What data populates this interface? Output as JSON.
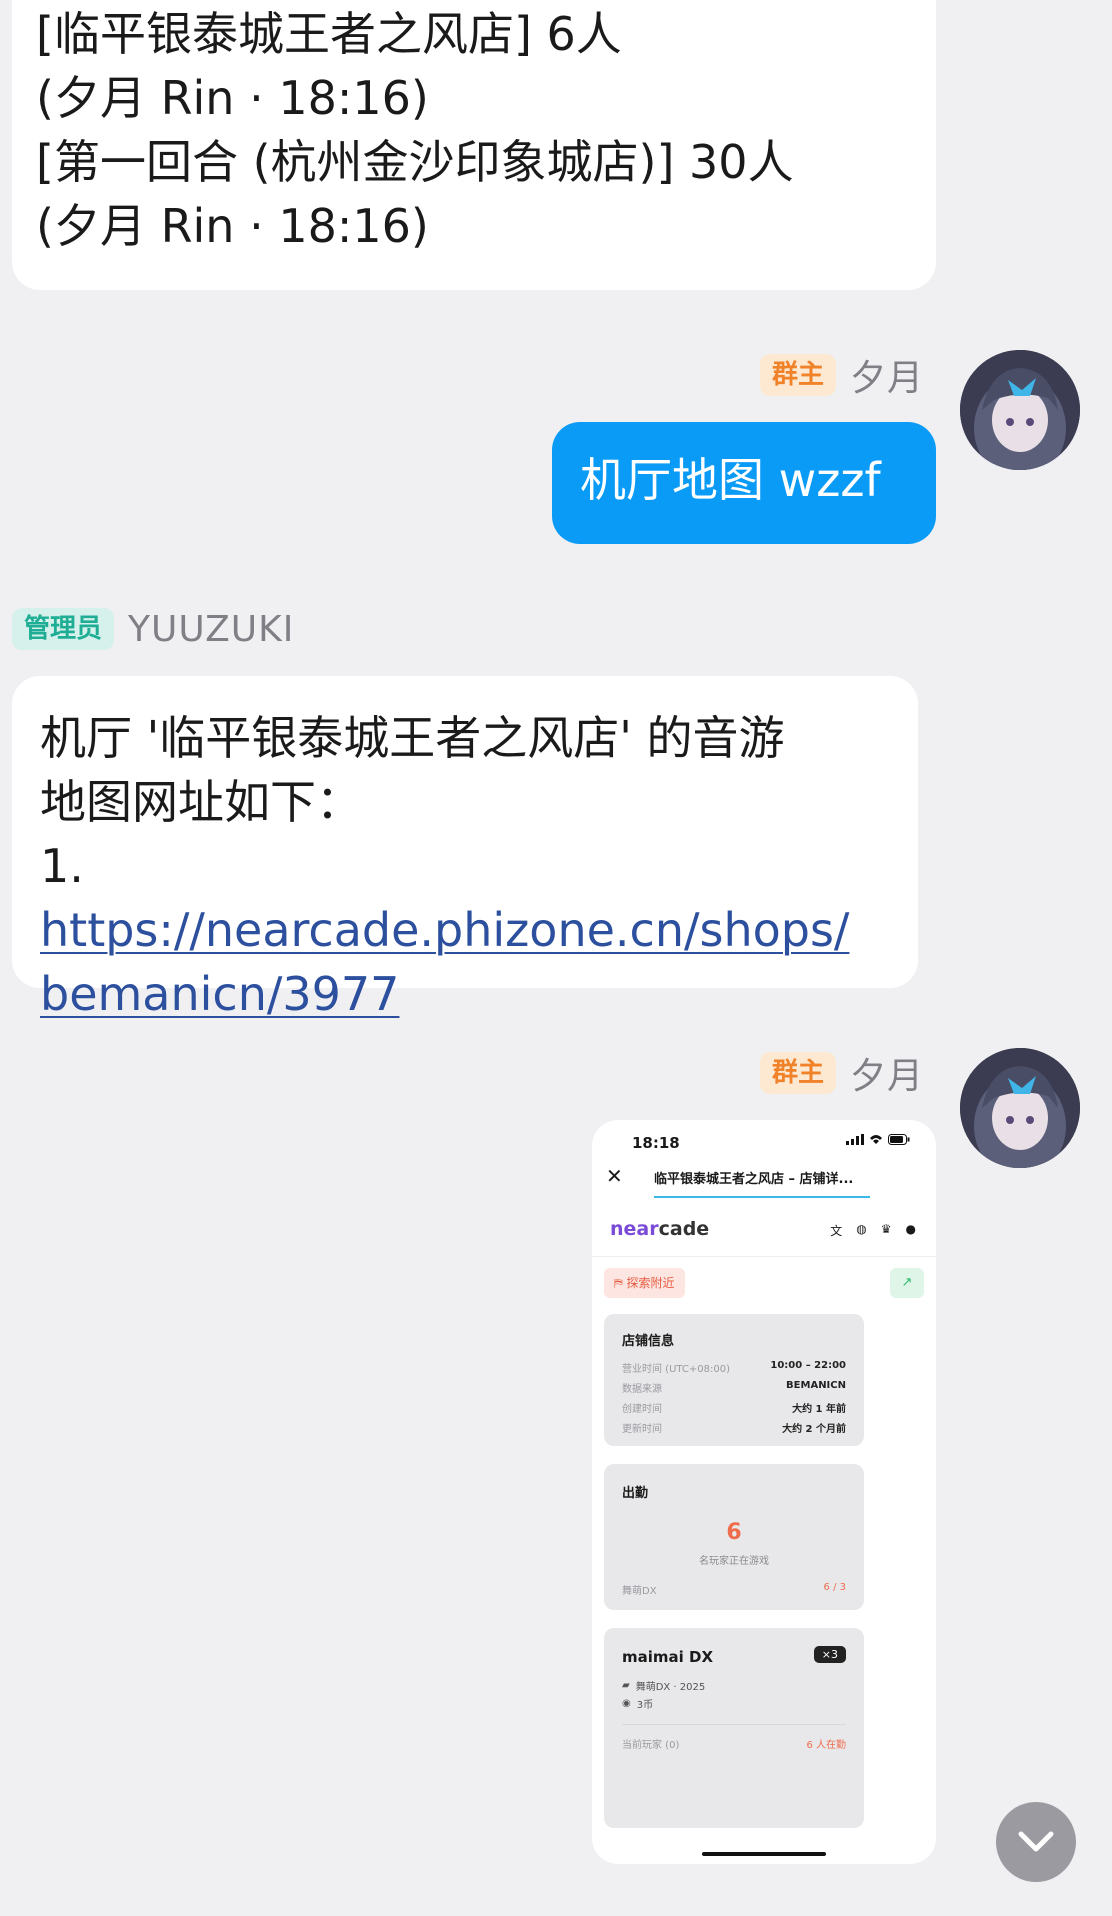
{
  "messages": {
    "m1": {
      "lines": [
        "[临平银泰城王者之风店] 6人",
        "(夕月 Rin · 18:16)",
        "[第一回合 (杭州金沙印象城店)] 30人",
        "(夕月 Rin · 18:16)"
      ]
    },
    "m2": {
      "badge": "群主",
      "sender": "夕月",
      "text": "机厅地图 wzzf"
    },
    "m3": {
      "badge": "管理员",
      "sender": "YUUZUKI",
      "line1": "机厅 '临平银泰城王者之风店' 的音游",
      "line2": "地图网址如下：",
      "list_prefix": "1. ",
      "link_part1": "https://nearcade.phizone.cn/shops/",
      "link_part2": "bemanicn/3977"
    },
    "m4": {
      "badge": "群主",
      "sender": "夕月"
    }
  },
  "screenshot": {
    "time": "18:18",
    "nav_title": "临平银泰城王者之风店 – 店铺详...",
    "logo_a": "near",
    "logo_b": "cade",
    "explore_label": "探索附近",
    "info_card": {
      "title": "店铺信息",
      "rows": [
        {
          "k": "营业时间 (UTC+08:00)",
          "v": "10:00 – 22:00"
        },
        {
          "k": "数据来源",
          "v": "BEMANICN"
        },
        {
          "k": "创建时间",
          "v": "大约 1 年前"
        },
        {
          "k": "更新时间",
          "v": "大约 2 个月前"
        }
      ]
    },
    "attendance": {
      "title": "出勤",
      "count": "6",
      "caption": "名玩家正在游戏",
      "game": "舞萌DX",
      "ratio": "6 / 3"
    },
    "machine": {
      "title": "maimai DX",
      "qty": "×3",
      "version": "舞萌DX · 2025",
      "cost": "3币",
      "players": "当前玩家 (0)",
      "online": "6 人在勤"
    }
  },
  "colors": {
    "outgoing_bubble": "#0a9bf6",
    "owner_badge": "#f0822a",
    "admin_badge": "#1fae95",
    "link": "#2c4f9e"
  }
}
